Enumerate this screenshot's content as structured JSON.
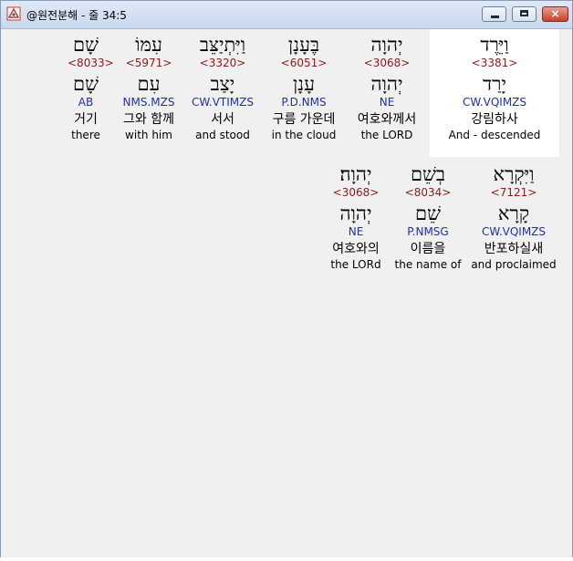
{
  "window": {
    "title": "@원전분해 - 줄 34:5",
    "buttons": {
      "minimize": "minimize",
      "maximize": "maximize",
      "close": "×"
    }
  },
  "rows": [
    {
      "words": [
        {
          "hebrew": "שָׁם",
          "strong": "<8033>",
          "lemma": "שָׁם",
          "morph": "AB",
          "korean": "거기",
          "english": "there"
        },
        {
          "hebrew": "עִמּוֹ",
          "strong": "<5971>",
          "lemma": "עִם",
          "morph": "NMS.MZS",
          "korean": "그와 함께",
          "english": "with him"
        },
        {
          "hebrew": "וַיִּתְיַצֵּב",
          "strong": "<3320>",
          "lemma": "יָצַב",
          "morph": "CW.VTIMZS",
          "korean": "서서",
          "english": "and stood"
        },
        {
          "hebrew": "בֶּעָנָן",
          "strong": "<6051>",
          "lemma": "עָנָן",
          "morph": "P.D.NMS",
          "korean": "구름 가운데",
          "english": "in the cloud"
        },
        {
          "hebrew": "יְהוָה",
          "strong": "<3068>",
          "lemma": "יְהוָה",
          "morph": "NE",
          "korean": "여호와께서",
          "english": "the LORD"
        },
        {
          "hebrew": "וַיֵּרֶד",
          "strong": "<3381>",
          "lemma": "יָרַד",
          "morph": "CW.VQIMZS",
          "korean": "강림하사",
          "english": "And - descended"
        }
      ]
    },
    {
      "words": [
        {
          "hebrew": "יְהוָה׃",
          "strong": "<3068>",
          "lemma": "יְהוָה",
          "morph": "NE",
          "korean": "여호와의",
          "english": "the LORd"
        },
        {
          "hebrew": "בְשֵׁם",
          "strong": "<8034>",
          "lemma": "שֵׁם",
          "morph": "P.NMSG",
          "korean": "이름을",
          "english": "the name of"
        },
        {
          "hebrew": "וַיִּקְרָא",
          "strong": "<7121>",
          "lemma": "קָרָא",
          "morph": "CW.VQIMZS",
          "korean": "반포하실새",
          "english": "and proclaimed"
        }
      ]
    }
  ]
}
